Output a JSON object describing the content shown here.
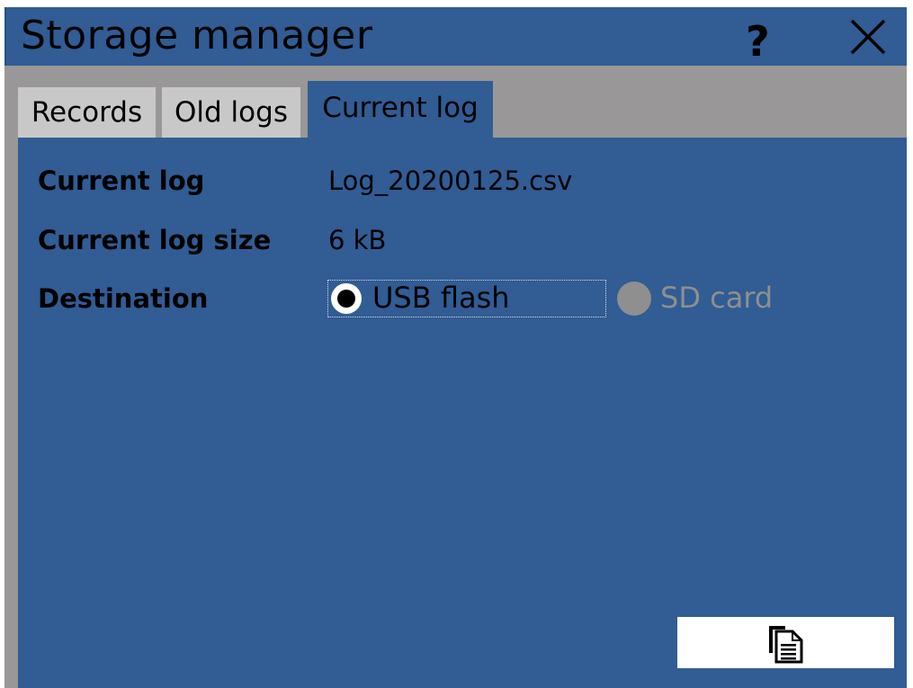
{
  "window": {
    "title": "Storage manager",
    "help_label": "?",
    "close_icon": "close-icon"
  },
  "tabs": [
    {
      "label": "Records",
      "active": false
    },
    {
      "label": "Old logs",
      "active": false
    },
    {
      "label": "Current log",
      "active": true
    }
  ],
  "current_log": {
    "name_label": "Current log",
    "name_value": "Log_20200125.csv",
    "size_label": "Current log size",
    "size_value": "6 kB",
    "destination_label": "Destination",
    "destinations": [
      {
        "label": "USB flash",
        "selected": true,
        "enabled": true
      },
      {
        "label": "SD card",
        "selected": false,
        "enabled": false
      }
    ]
  },
  "actions": {
    "copy_icon": "copy-document-icon"
  },
  "colors": {
    "panel": "#315c94",
    "tabstrip": "#999797",
    "tab_inactive": "#c8c8c8",
    "disabled": "#8f8f8f"
  }
}
